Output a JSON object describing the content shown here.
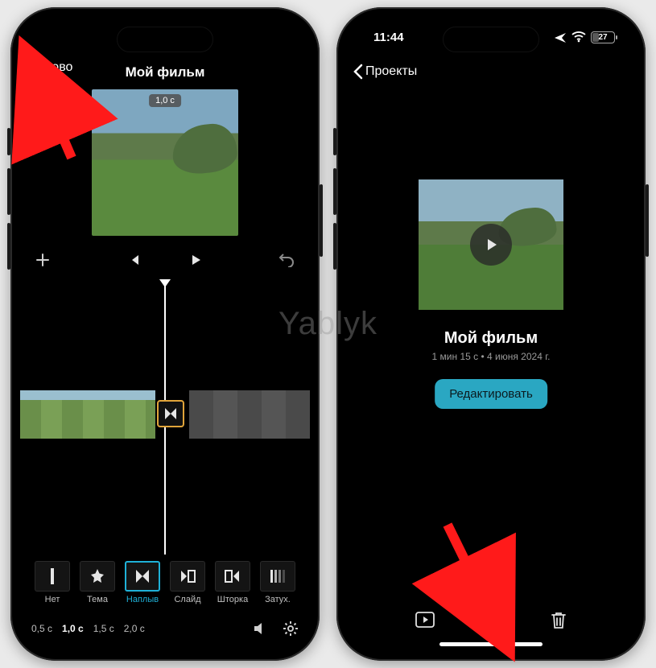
{
  "watermark": "Yablyk",
  "left": {
    "done": "Готово",
    "title": "Мой фильм",
    "clip_duration_badge": "1,0 с",
    "transitions": [
      {
        "key": "none",
        "label": "Нет"
      },
      {
        "key": "theme",
        "label": "Тема"
      },
      {
        "key": "dissolve",
        "label": "Наплыв"
      },
      {
        "key": "slide",
        "label": "Слайд"
      },
      {
        "key": "wipe",
        "label": "Шторка"
      },
      {
        "key": "fade",
        "label": "Затух."
      }
    ],
    "selected_transition_index": 2,
    "durations": [
      "0,5 с",
      "1,0 с",
      "1,5 с",
      "2,0 с"
    ],
    "selected_duration_index": 1
  },
  "right": {
    "status": {
      "time": "11:44",
      "battery": "27"
    },
    "back_label": "Проекты",
    "project_title": "Мой фильм",
    "project_meta": "1 мин 15 с • 4 июня 2024 г.",
    "edit_button": "Редактировать"
  },
  "colors": {
    "accent": "#1fb1d8",
    "button": "#2aa7c2",
    "transition_border": "#e0a43a"
  }
}
